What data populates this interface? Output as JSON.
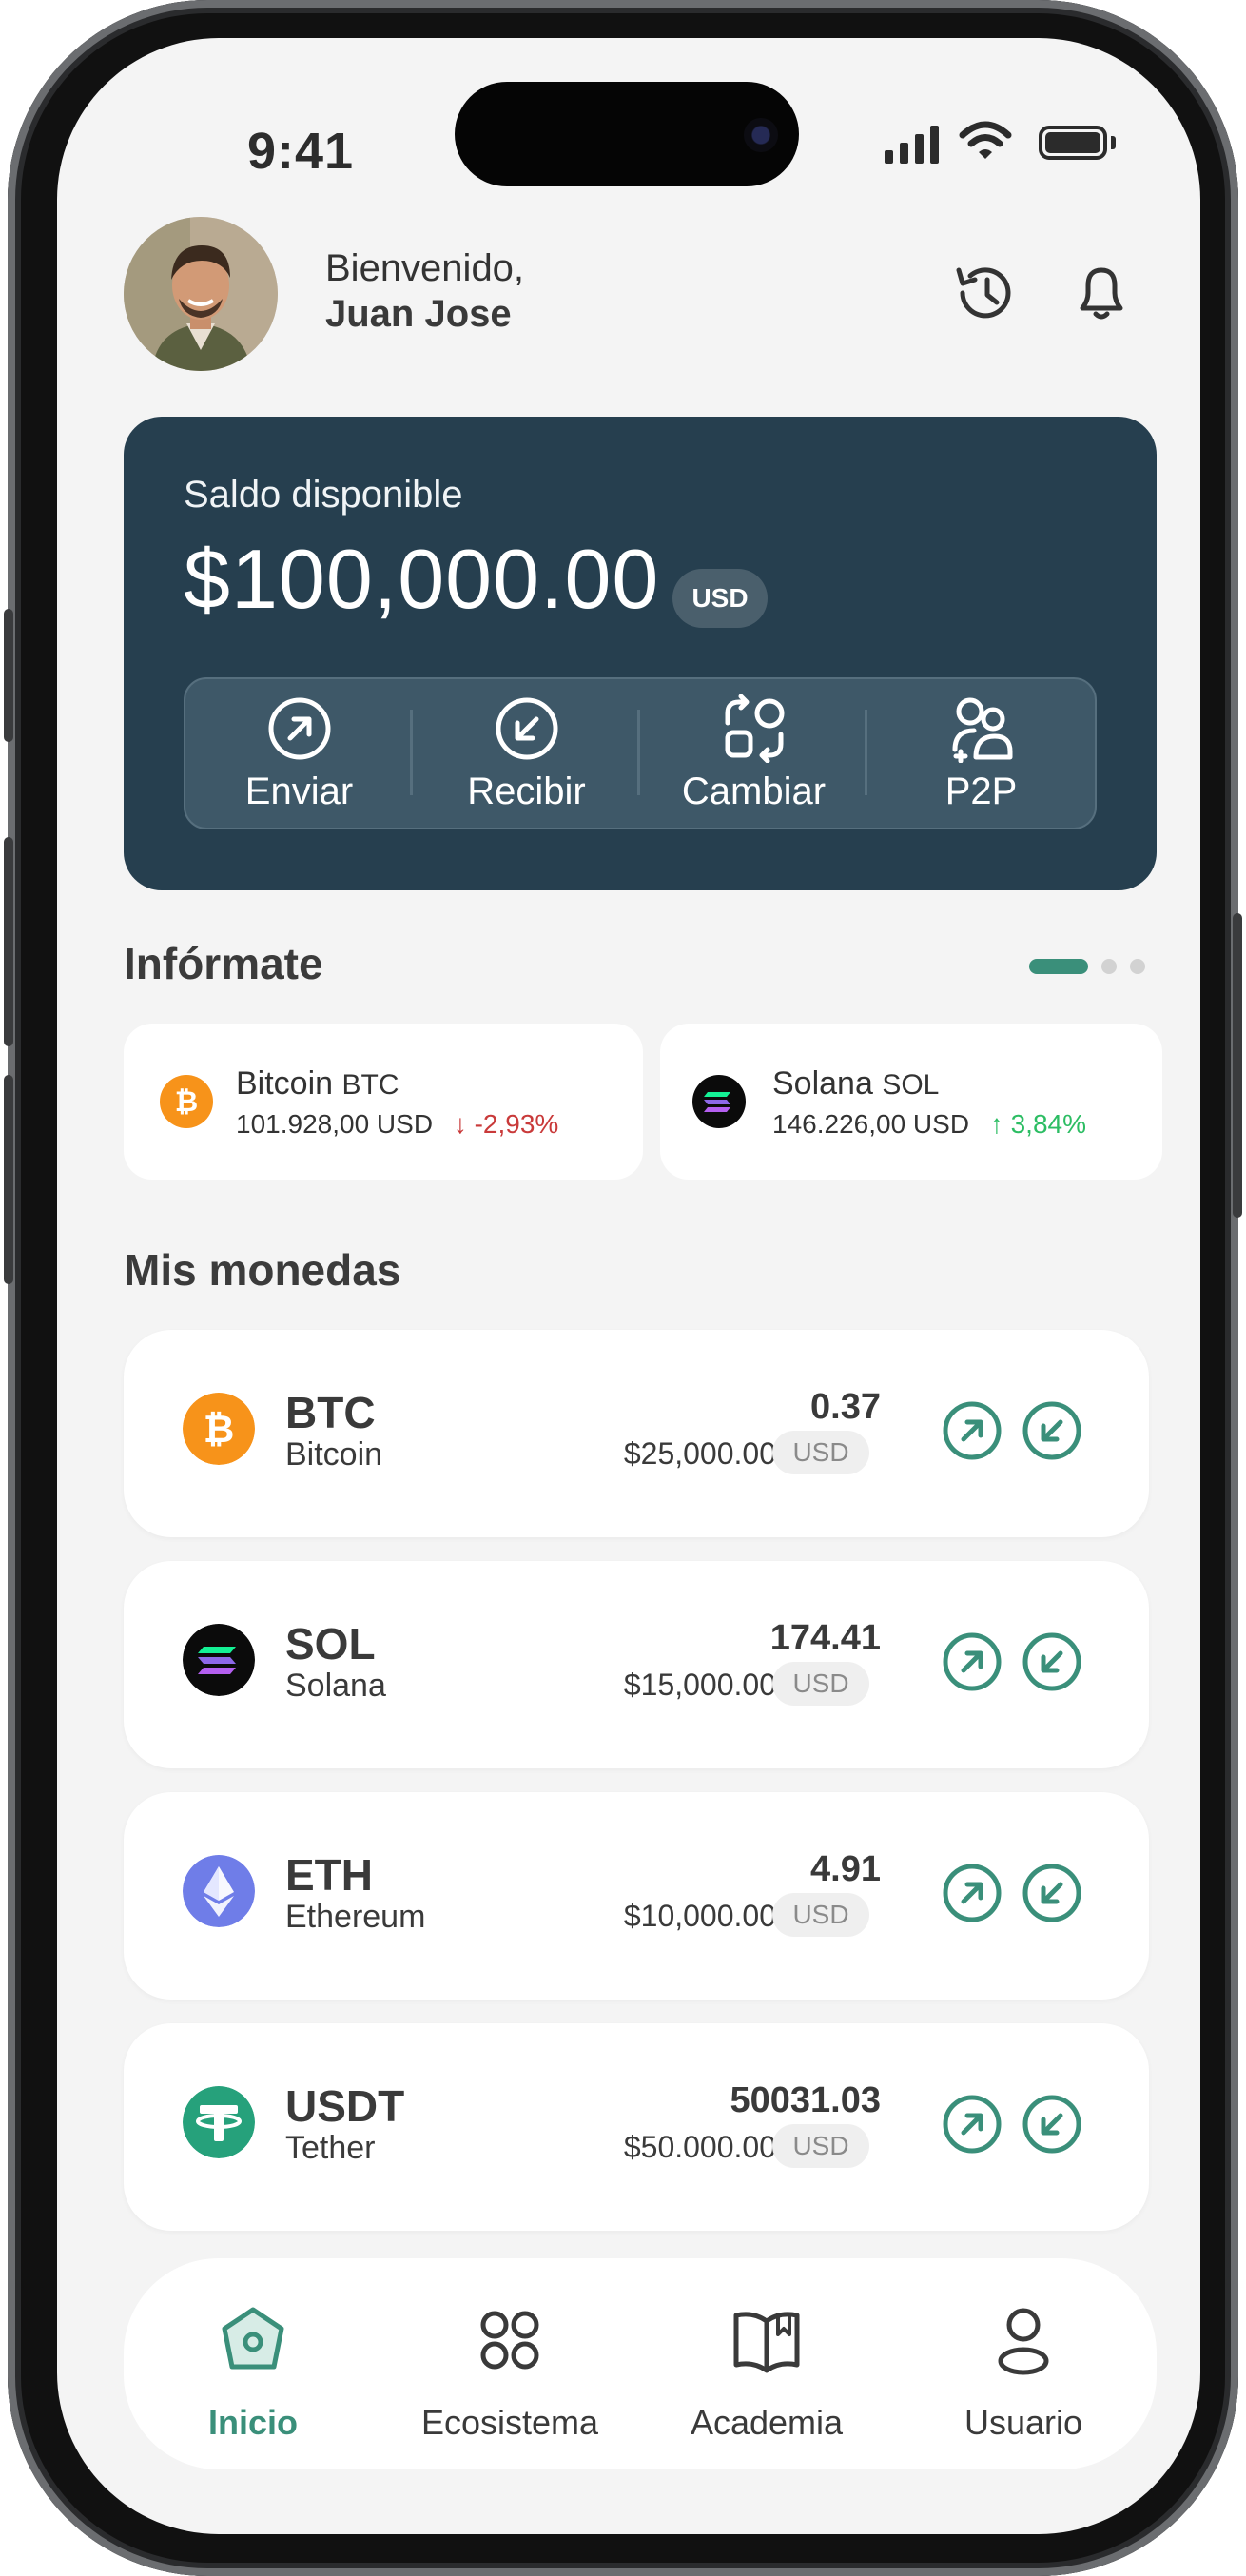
{
  "status_bar": {
    "time": "9:41"
  },
  "header": {
    "greeting": "Bienvenido,",
    "user_name": "Juan Jose"
  },
  "balance": {
    "label": "Saldo disponible",
    "amount": "$100,000.00",
    "currency": "USD",
    "actions": [
      {
        "label": "Enviar",
        "icon": "send-arrow-icon"
      },
      {
        "label": "Recibir",
        "icon": "receive-arrow-icon"
      },
      {
        "label": "Cambiar",
        "icon": "exchange-icon"
      },
      {
        "label": "P2P",
        "icon": "p2p-users-icon"
      }
    ]
  },
  "info": {
    "title": "Infórmate",
    "tickers": [
      {
        "name": "Bitcoin",
        "symbol": "BTC",
        "price": "101.928,00 USD",
        "change": "↓ -2,93%",
        "direction": "down"
      },
      {
        "name": "Solana",
        "symbol": "SOL",
        "price": "146.226,00 USD",
        "change": "↑ 3,84%",
        "direction": "up"
      }
    ]
  },
  "coins": {
    "title": "Mis monedas",
    "items": [
      {
        "symbol": "BTC",
        "name": "Bitcoin",
        "amount": "0.37",
        "usd_value": "$25,000.00",
        "currency": "USD"
      },
      {
        "symbol": "SOL",
        "name": "Solana",
        "amount": "174.41",
        "usd_value": "$15,000.00",
        "currency": "USD"
      },
      {
        "symbol": "ETH",
        "name": "Ethereum",
        "amount": "4.91",
        "usd_value": "$10,000.00",
        "currency": "USD"
      },
      {
        "symbol": "USDT",
        "name": "Tether",
        "amount": "50031.03",
        "usd_value": "$50.000.00",
        "currency": "USD"
      }
    ]
  },
  "nav": {
    "items": [
      {
        "label": "Inicio",
        "icon": "home-icon",
        "active": true
      },
      {
        "label": "Ecosistema",
        "icon": "grid-circles-icon",
        "active": false
      },
      {
        "label": "Academia",
        "icon": "book-icon",
        "active": false
      },
      {
        "label": "Usuario",
        "icon": "user-icon",
        "active": false
      }
    ]
  },
  "colors": {
    "card_bg": "#263f4f",
    "accent": "#3a8f7a",
    "negative": "#c93a3a",
    "positive": "#2cbd63",
    "btc": "#f7931a",
    "eth": "#6f7de8",
    "usdt": "#26a17b"
  }
}
